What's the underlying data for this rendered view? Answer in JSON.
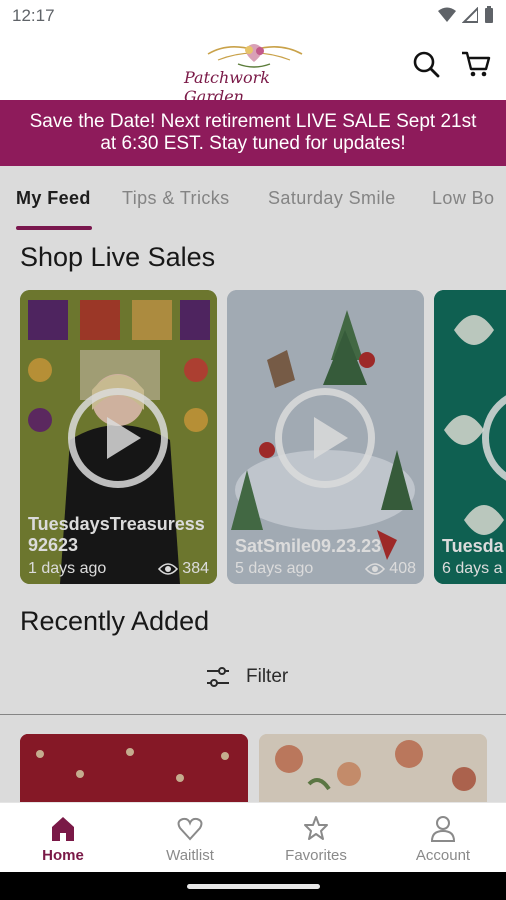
{
  "status_bar": {
    "time": "12:17"
  },
  "header": {
    "logo_text": "Patchwork Garden",
    "search_icon": "search-icon",
    "cart_icon": "cart-icon"
  },
  "banner": {
    "text": "Save the Date! Next retirement LIVE SALE Sept 21st at 6:30 EST. Stay tuned for updates!"
  },
  "tabs": [
    {
      "label": "My Feed"
    },
    {
      "label": "Tips & Tricks"
    },
    {
      "label": "Saturday Smile"
    },
    {
      "label": "Low Bo"
    }
  ],
  "shop_live_sales": {
    "title": "Shop Live Sales",
    "cards": [
      {
        "title": "TuesdaysTreasuress 92623",
        "age": "1 days ago",
        "views": "384"
      },
      {
        "title": "SatSmile09.23.23",
        "age": "5 days ago",
        "views": "408"
      },
      {
        "title": "Tuesda",
        "age": "6 days a",
        "views": ""
      }
    ]
  },
  "recently_added": {
    "title": "Recently Added",
    "filter_label": "Filter"
  },
  "bottom_nav": [
    {
      "label": "Home",
      "icon": "home-icon"
    },
    {
      "label": "Waitlist",
      "icon": "heart-icon"
    },
    {
      "label": "Favorites",
      "icon": "star-icon"
    },
    {
      "label": "Account",
      "icon": "person-icon"
    }
  ],
  "colors": {
    "brand": "#8e1b5b",
    "brand_dark": "#7a1947"
  }
}
